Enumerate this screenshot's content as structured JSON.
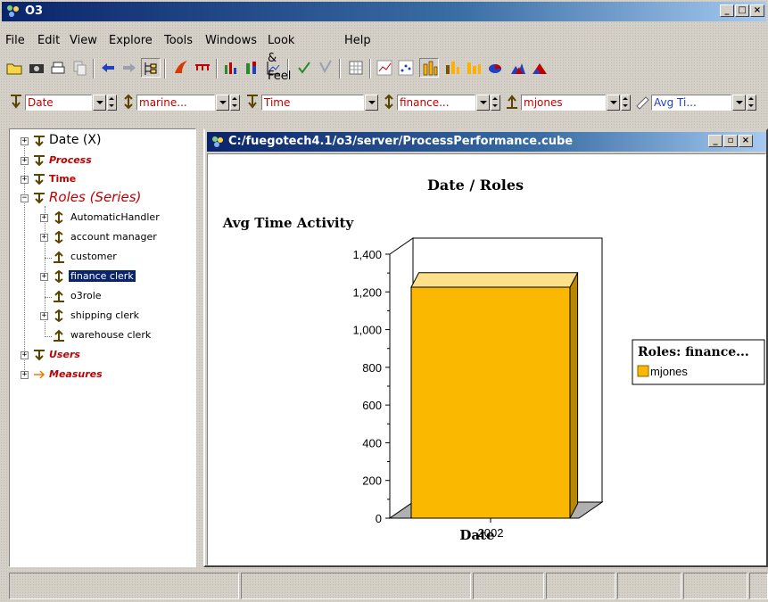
{
  "window": {
    "title": "O3"
  },
  "menu": [
    {
      "label": "File",
      "u": "F",
      "rest": "ile"
    },
    {
      "label": "Edit",
      "u": "E",
      "rest": "dit"
    },
    {
      "label": "View",
      "u": "V",
      "rest": "iew"
    },
    {
      "label": "Explore",
      "u": "E",
      "rest": "xplore"
    },
    {
      "label": "Tools",
      "u": "T",
      "rest": "ools"
    },
    {
      "label": "Windows",
      "u": "W",
      "rest": "indows"
    },
    {
      "label": "Look & Feel",
      "u": "L",
      "rest": "ook & Feel"
    },
    {
      "label": "Help",
      "u": "H",
      "rest": "elp"
    }
  ],
  "dimension_bar": {
    "fields": [
      {
        "value": "Date",
        "icon": "down-arrow-icon"
      },
      {
        "value": "marine...",
        "icon": "up-down-arrow-icon"
      },
      {
        "value": "Time",
        "icon": "down-arrow-icon"
      },
      {
        "value": "finance...",
        "icon": "up-down-arrow-icon"
      },
      {
        "value": "mjones",
        "icon": "up-arrow-icon"
      },
      {
        "value": "Avg Ti...",
        "icon": "ruler-icon"
      }
    ]
  },
  "tree": {
    "items": [
      {
        "label": "Date (X)"
      },
      {
        "label": "Process"
      },
      {
        "label": "Time"
      },
      {
        "label": "Roles (Series)"
      },
      {
        "label": "AutomaticHandler"
      },
      {
        "label": "account manager"
      },
      {
        "label": "customer"
      },
      {
        "label": "finance clerk"
      },
      {
        "label": "o3role"
      },
      {
        "label": "shipping clerk"
      },
      {
        "label": "warehouse clerk"
      },
      {
        "label": "Users"
      },
      {
        "label": "Measures"
      }
    ]
  },
  "inner_window": {
    "title": "C:/fuegotech4.1/o3/server/ProcessPerformance.cube"
  },
  "colors": {
    "titlebar": "#0a246a",
    "bar_front": "#fbb800",
    "bar_top": "#fde08a",
    "bar_side": "#b88600",
    "tree_red": "#c00000"
  },
  "chart_data": {
    "type": "bar",
    "title": "Date / Roles",
    "ylabel": "Avg Time Activity",
    "xlabel": "Date",
    "categories": [
      "2002"
    ],
    "series": [
      {
        "name": "mjones",
        "values": [
          1225
        ]
      }
    ],
    "ylim": [
      0,
      1400
    ],
    "yticks": [
      "0",
      "200",
      "400",
      "600",
      "800",
      "1,000",
      "1,200",
      "1,400"
    ],
    "legend_title": "Roles: finance...",
    "legend_position": "right"
  }
}
